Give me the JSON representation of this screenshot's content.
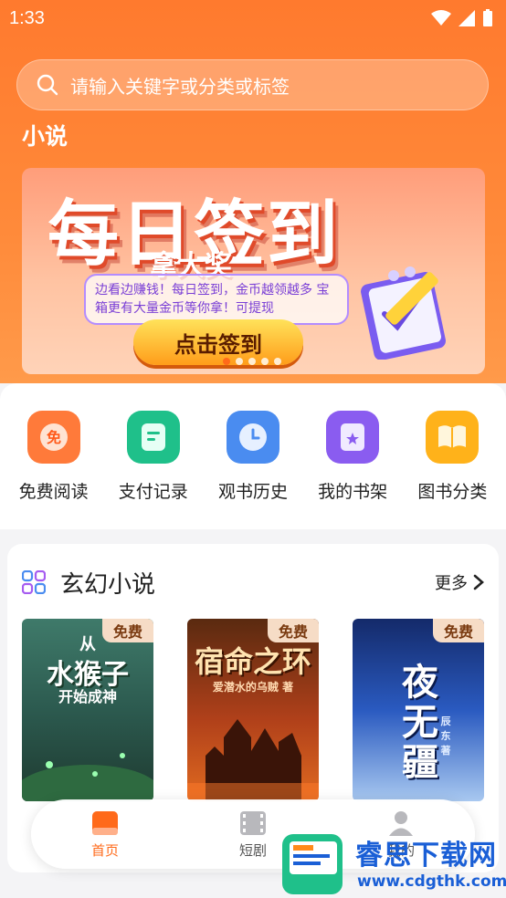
{
  "status": {
    "time": "1:33"
  },
  "search": {
    "placeholder": "请输入关键字或分类或标签"
  },
  "section": {
    "title": "小说"
  },
  "banner": {
    "title": "每日签到",
    "subtitle": "拿大奖",
    "description": "边看边赚钱！每日签到，金币越领越多 宝箱更有大量金币等你拿！可提现",
    "cta": "点击签到",
    "dots_total": 6,
    "active_dot": 0
  },
  "quick_actions": [
    {
      "label": "免费阅读",
      "icon": "free-read-icon",
      "color": "#ff6a2a"
    },
    {
      "label": "支付记录",
      "icon": "payment-record-icon",
      "color": "#1fc08a"
    },
    {
      "label": "观书历史",
      "icon": "history-clock-icon",
      "color": "#4a8cf0"
    },
    {
      "label": "我的书架",
      "icon": "bookshelf-icon",
      "color": "#8a5cf0"
    },
    {
      "label": "图书分类",
      "icon": "book-category-icon",
      "color": "#ffb21a"
    }
  ],
  "category": {
    "title": "玄幻小说",
    "more": "更多",
    "books": [
      {
        "badge": "免费",
        "cover_line1": "从",
        "cover_line2": "水猴子",
        "cover_line3": "开始成神"
      },
      {
        "badge": "免费",
        "cover_line1": "宿命之环",
        "cover_line2": "爱潜水的乌贼 著"
      },
      {
        "badge": "免费",
        "cover_line1": "夜无疆",
        "cover_line2": "辰东 著"
      }
    ]
  },
  "tabbar": {
    "tabs": [
      {
        "label": "首页",
        "active": true
      },
      {
        "label": "短剧",
        "active": false
      },
      {
        "label": "我的",
        "active": false
      }
    ]
  },
  "watermark": {
    "brand": "睿思下载网",
    "url": "www.cdgthk.com"
  },
  "colors": {
    "accent": "#ff7a2e",
    "active_tab": "#ff6a1a"
  }
}
